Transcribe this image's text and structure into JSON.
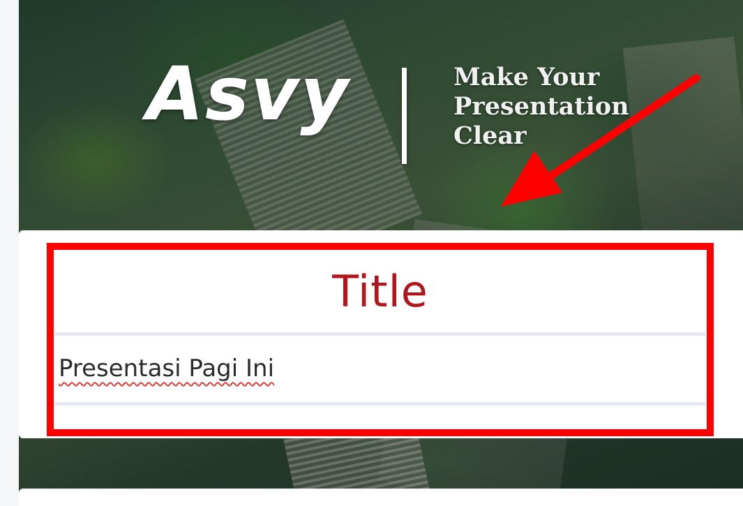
{
  "header": {
    "logo_text": "Asvy",
    "tagline": [
      "Make Your",
      "Presentation",
      "Clear"
    ]
  },
  "form": {
    "section_title": "Title",
    "title_value": "Presentasi Pagi Ini"
  },
  "annotations": {
    "highlight_color": "#ff0000",
    "arrow_color": "#ff0000"
  },
  "colors": {
    "title_red": "#b0161c",
    "spellcheck_underline": "#e03a3a"
  }
}
